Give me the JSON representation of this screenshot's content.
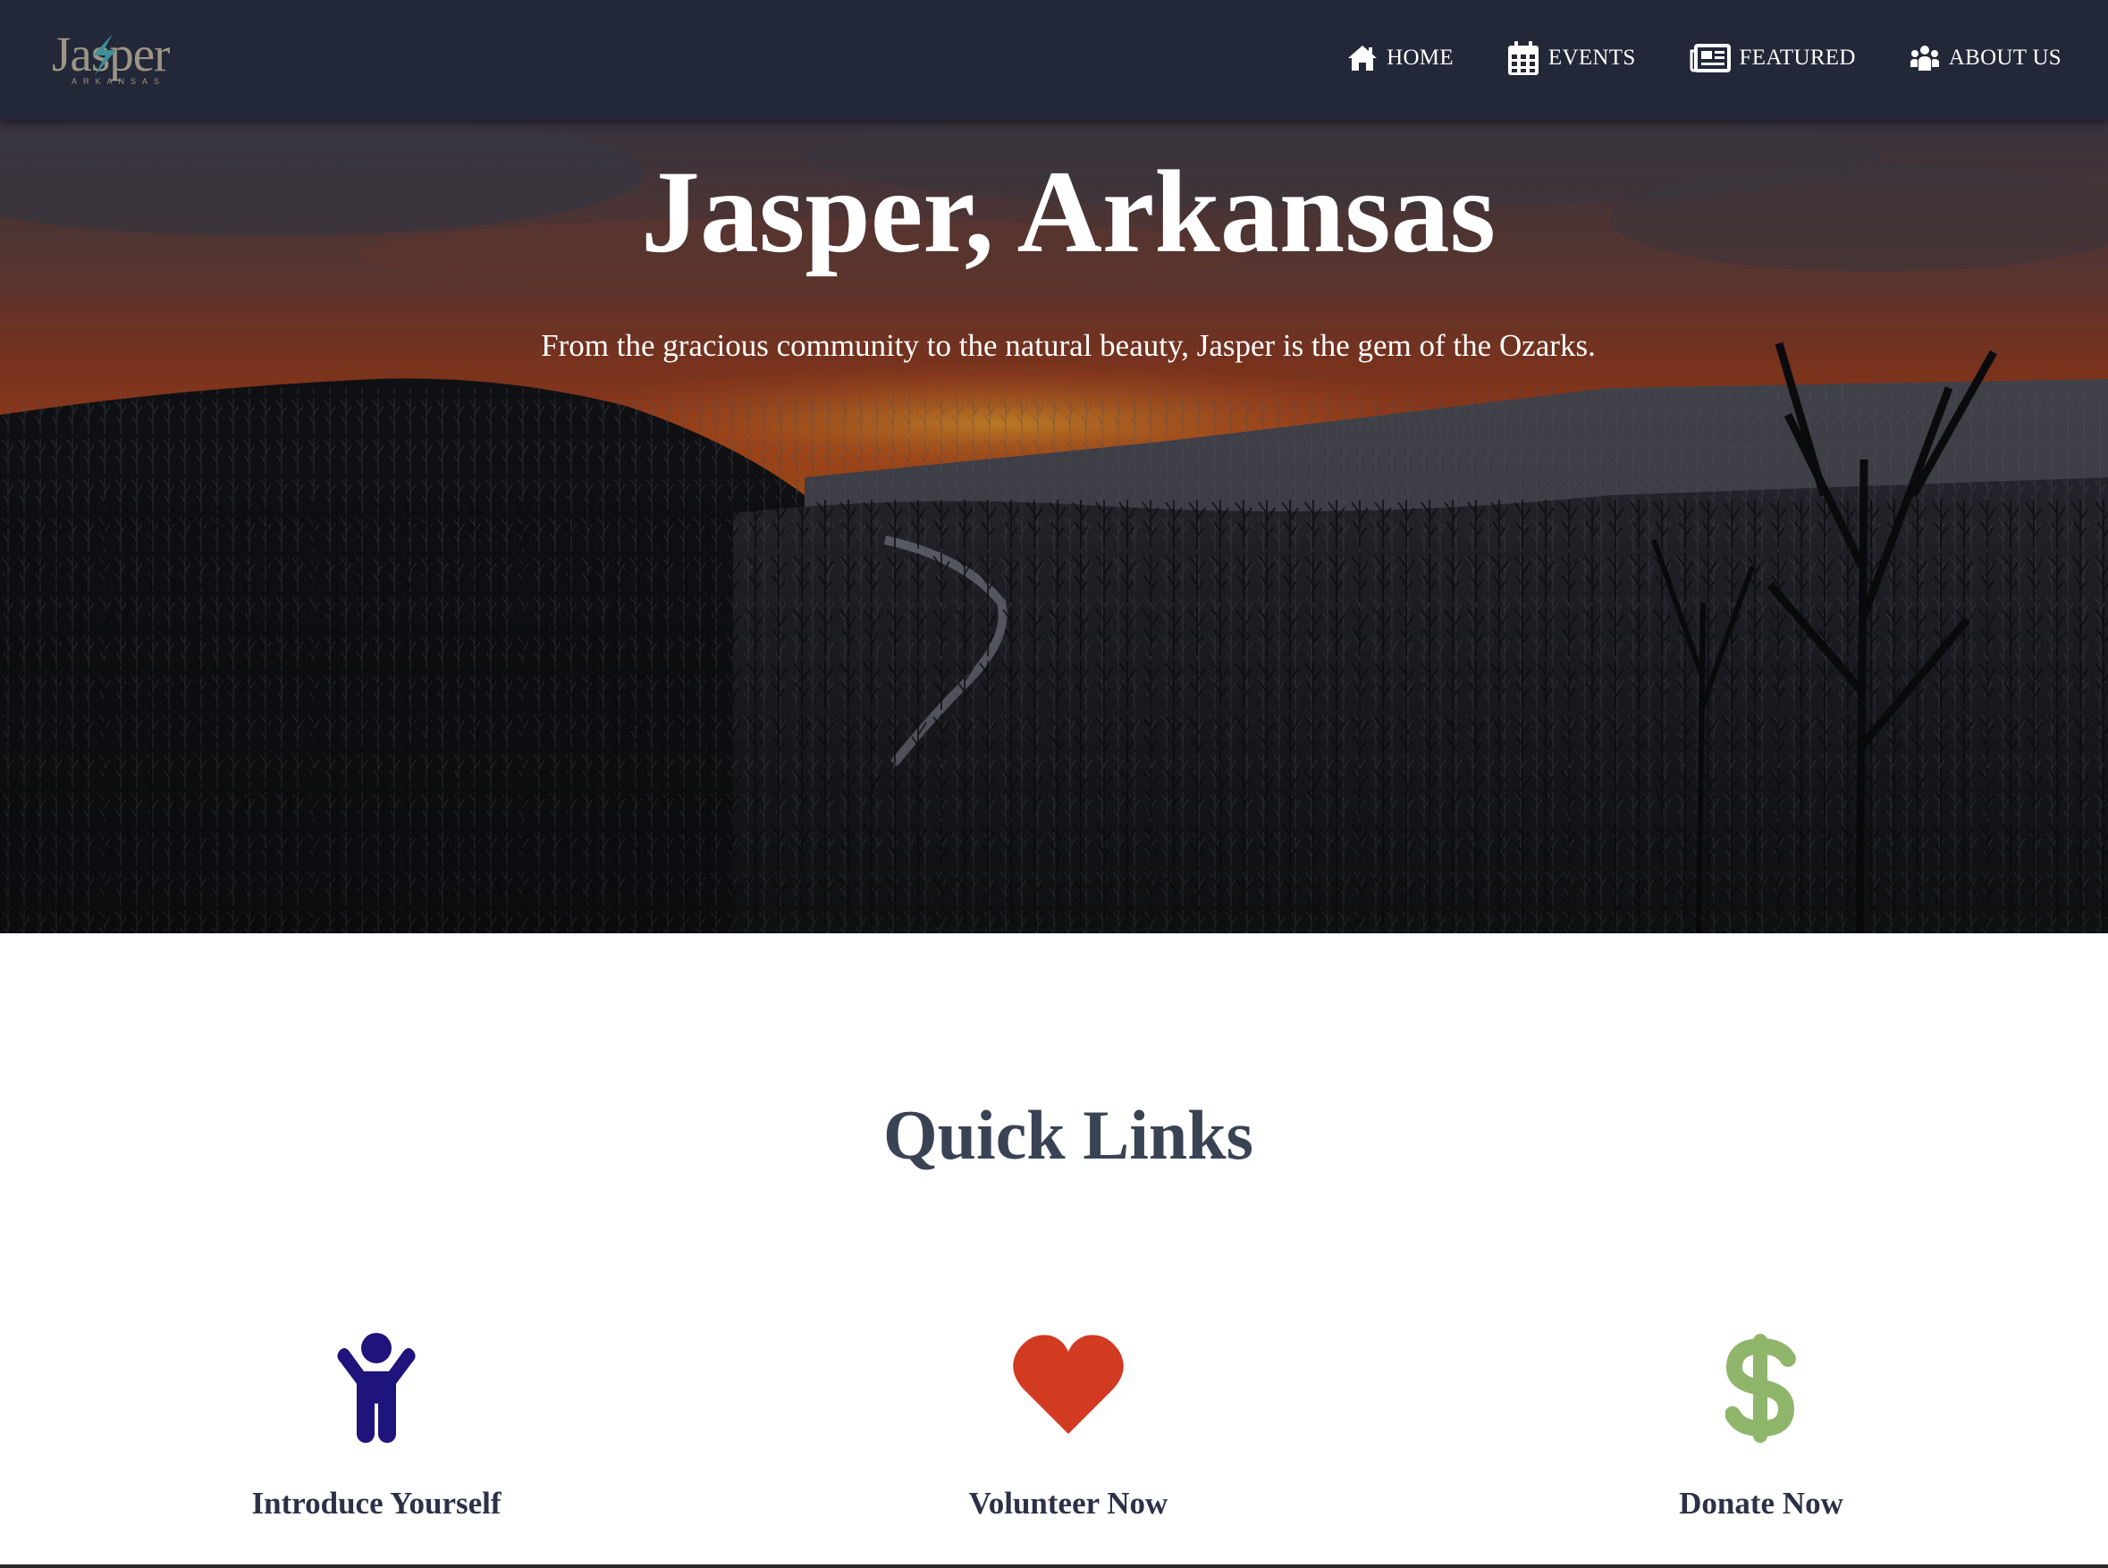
{
  "brand": {
    "logo_word": "Jasper",
    "logo_sub": "ARKANSAS",
    "logo_bolt_color": "#3e8f9a",
    "logo_text_color": "#9d9585"
  },
  "nav": {
    "items": [
      {
        "label": "HOME",
        "icon": "home-icon"
      },
      {
        "label": "EVENTS",
        "icon": "calendar-icon"
      },
      {
        "label": "FEATURED",
        "icon": "newspaper-icon"
      },
      {
        "label": "ABOUT US",
        "icon": "users-icon"
      }
    ]
  },
  "hero": {
    "title": "Jasper, Arkansas",
    "subtitle": "From the gracious community to the natural beauty, Jasper is the gem of the Ozarks."
  },
  "quick_links": {
    "title": "Quick Links",
    "items": [
      {
        "label": "Introduce Yourself",
        "icon": "person-arms-up-icon",
        "color": "#1f137c"
      },
      {
        "label": "Volunteer Now",
        "icon": "heart-icon",
        "color": "#d23a22"
      },
      {
        "label": "Donate Now",
        "icon": "dollar-icon",
        "color": "#8fb56b"
      }
    ]
  },
  "colors": {
    "navbar": "#222838",
    "heading": "#394354",
    "link_label": "#2c3147"
  }
}
